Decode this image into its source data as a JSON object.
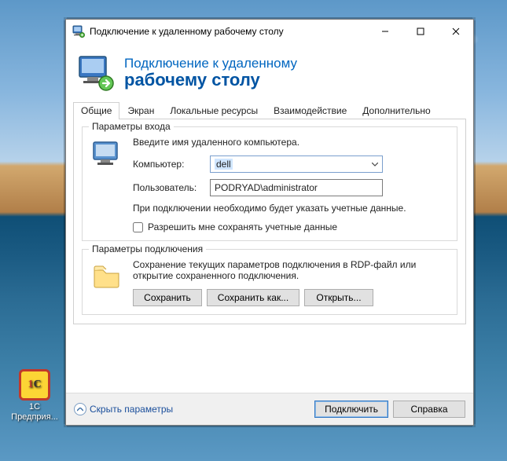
{
  "desktop_icon": {
    "label": "1C\nПредприя..."
  },
  "window": {
    "title": "Подключение к удаленному рабочему столу",
    "banner": {
      "line1": "Подключение к удаленному",
      "line2": "рабочему столу"
    },
    "tabs": {
      "general": "Общие",
      "display": "Экран",
      "local": "Локальные ресурсы",
      "experience": "Взаимодействие",
      "advanced": "Дополнительно"
    },
    "login_group": {
      "legend": "Параметры входа",
      "intro": "Введите имя удаленного компьютера.",
      "computer_label": "Компьютер:",
      "computer_value": "dell",
      "user_label": "Пользователь:",
      "user_value": "PODRYAD\\administrator",
      "hint": "При подключении необходимо будет указать учетные данные.",
      "checkbox_label": "Разрешить мне сохранять учетные данные"
    },
    "conn_group": {
      "legend": "Параметры подключения",
      "intro": "Сохранение текущих параметров подключения в RDP-файл или открытие сохраненного подключения.",
      "save": "Сохранить",
      "saveas": "Сохранить как...",
      "open": "Открыть..."
    },
    "footer": {
      "collapse": "Скрыть параметры",
      "connect": "Подключить",
      "help": "Справка"
    }
  }
}
